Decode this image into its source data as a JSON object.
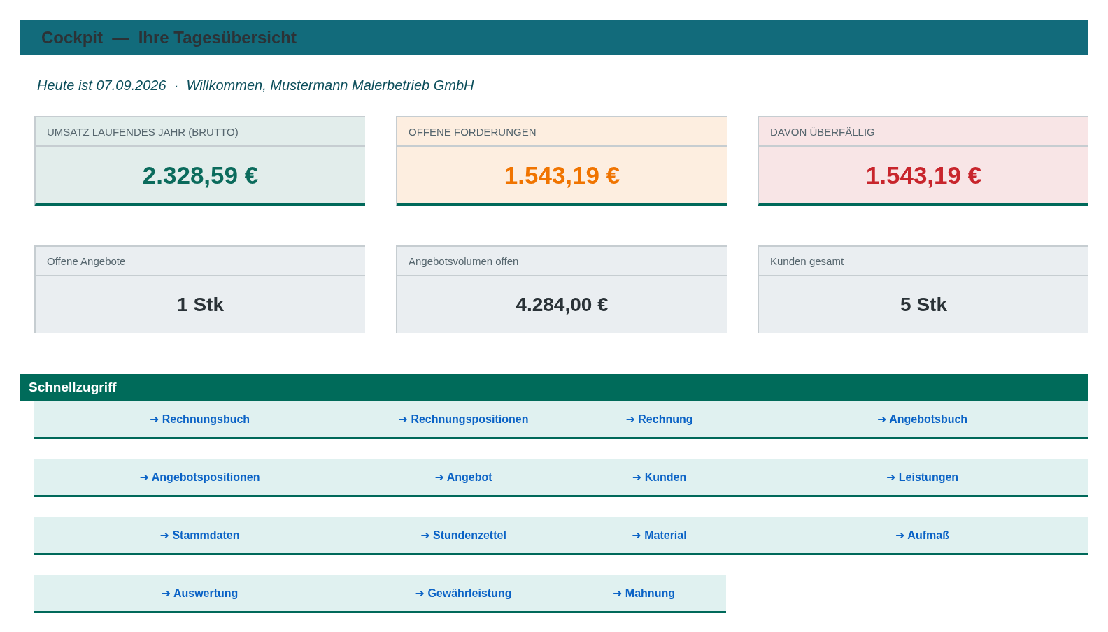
{
  "title": "Cockpit  —  Ihre Tagesübersicht",
  "greeting": "Heute ist 07.09.2026  ·  Willkommen, Mustermann Malerbetrieb GmbH",
  "kpi_cards": [
    {
      "label": "UMSATZ LAUFENDES JAHR (BRUTTO)",
      "value": "2.328,59 €",
      "color": "#0b6b5c"
    },
    {
      "label": "OFFENE FORDERUNGEN",
      "value": "1.543,19 €",
      "color": "#f07400"
    },
    {
      "label": "DAVON ÜBERFÄLLIG",
      "value": "1.543,19 €",
      "color": "#c8252c"
    }
  ],
  "stat_cards": [
    {
      "label": "Offene Angebote",
      "value": "1 Stk"
    },
    {
      "label": "Angebotsvolumen offen",
      "value": "4.284,00 €"
    },
    {
      "label": "Kunden gesamt",
      "value": "5 Stk"
    }
  ],
  "quick_access": {
    "title": "Schnellzugriff",
    "rows": [
      [
        "➜ Rechnungsbuch",
        "➜ Rechnungspositionen",
        "➜ Rechnung",
        "➜ Angebotsbuch"
      ],
      [
        "➜ Angebotspositionen",
        "➜ Angebot",
        "➜ Kunden",
        "➜ Leistungen"
      ],
      [
        "➜ Stammdaten",
        "➜ Stundenzettel",
        "➜ Material",
        "➜ Aufmaß"
      ],
      [
        "➜ Auswertung",
        "➜ Gewährleistung",
        "➜ Mahnung"
      ]
    ]
  }
}
